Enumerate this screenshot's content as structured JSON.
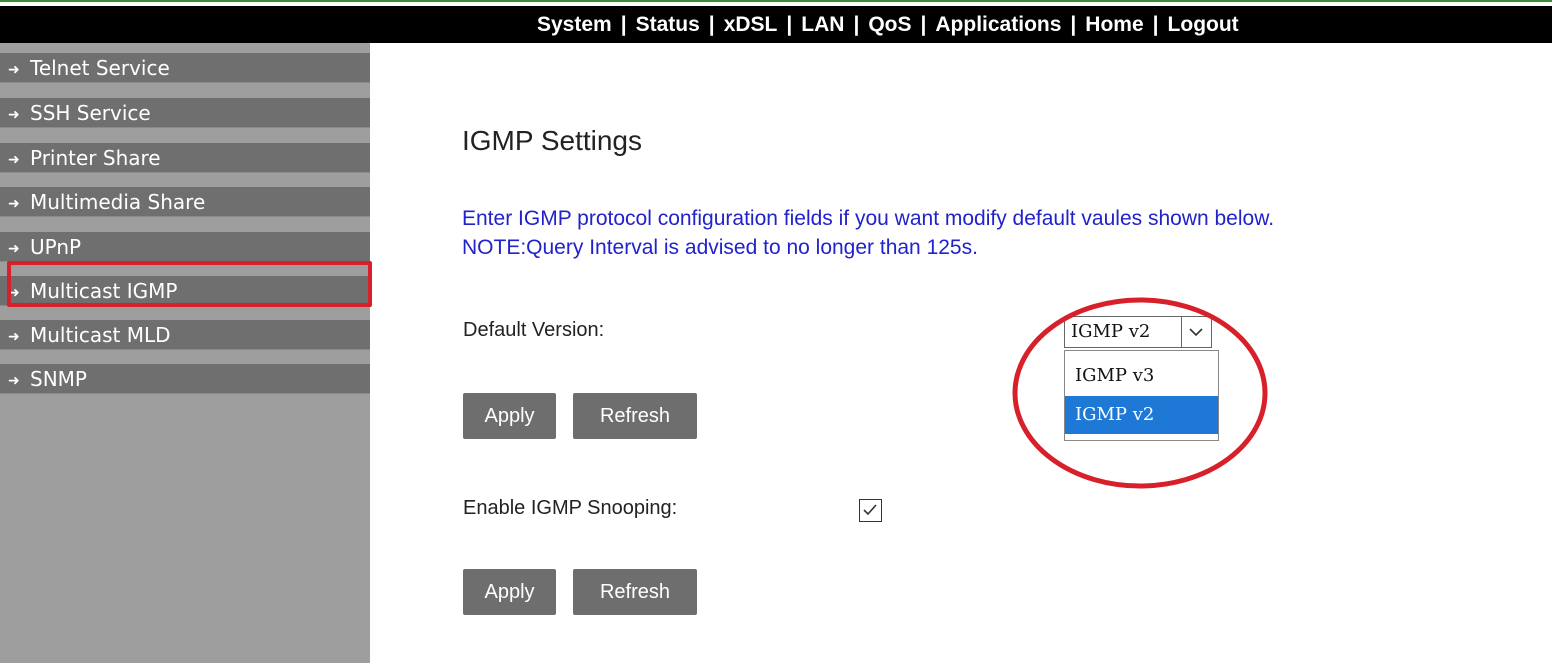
{
  "nav": {
    "items": [
      {
        "label": "System"
      },
      {
        "label": "Status"
      },
      {
        "label": "xDSL"
      },
      {
        "label": "LAN"
      },
      {
        "label": "QoS"
      },
      {
        "label": "Applications"
      },
      {
        "label": "Home"
      },
      {
        "label": "Logout"
      }
    ],
    "separator": "|"
  },
  "sidebar": {
    "items": [
      {
        "label": "Telnet Service",
        "icon": "arrow-right-icon"
      },
      {
        "label": "SSH Service",
        "icon": "arrow-right-icon"
      },
      {
        "label": "Printer Share",
        "icon": "arrow-right-icon"
      },
      {
        "label": "Multimedia Share",
        "icon": "arrow-right-icon"
      },
      {
        "label": "UPnP",
        "icon": "arrow-right-icon"
      },
      {
        "label": "Multicast IGMP",
        "icon": "arrow-right-icon",
        "highlighted": true
      },
      {
        "label": "Multicast MLD",
        "icon": "arrow-right-icon"
      },
      {
        "label": "SNMP",
        "icon": "arrow-right-icon"
      }
    ]
  },
  "main": {
    "title": "IGMP Settings",
    "note_line1": "Enter IGMP protocol configuration fields if you want modify default vaules shown below.",
    "note_line2": "NOTE:Query Interval is advised to no longer than 125s.",
    "default_version": {
      "label": "Default Version:",
      "selected": "IGMP v2",
      "options": [
        "IGMP v3",
        "IGMP v2"
      ],
      "highlighted_option": "IGMP v2"
    },
    "version_buttons": {
      "apply": "Apply",
      "refresh": "Refresh"
    },
    "snooping": {
      "label": "Enable IGMP Snooping:",
      "checked": true
    },
    "snooping_buttons": {
      "apply": "Apply",
      "refresh": "Refresh"
    }
  },
  "colors": {
    "topbar_bg": "#000000",
    "sidebar_item_bg": "#6f6f6f",
    "sidebar_bg": "#9e9e9e",
    "note_text": "#2222cc",
    "button_bg": "#6e6e6e",
    "selected_option_bg": "#1e78d6",
    "annotation_red": "#d8202a"
  }
}
